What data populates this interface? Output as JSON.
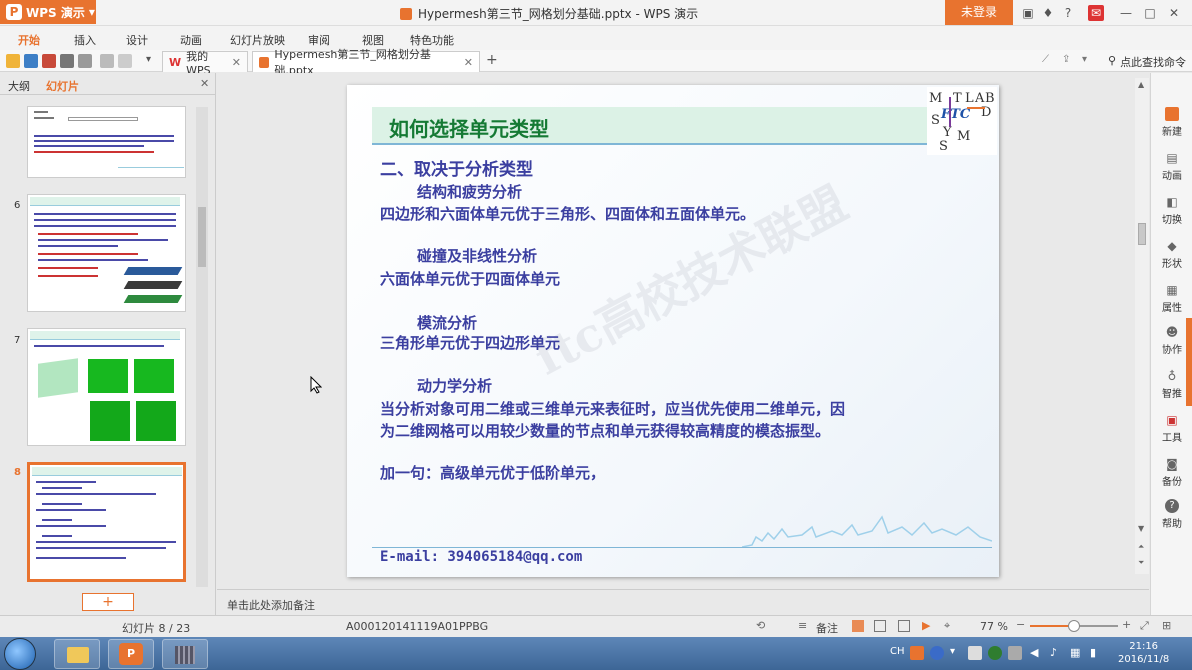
{
  "app": {
    "name": "WPS 演示",
    "doc_title": "Hypermesh第三节_网格划分基础.pptx - WPS 演示",
    "login_label": "未登录"
  },
  "menu": [
    "开始",
    "插入",
    "设计",
    "动画",
    "幻灯片放映",
    "审阅",
    "视图",
    "特色功能"
  ],
  "doc_tabs": [
    {
      "label": "我的WPS"
    },
    {
      "label": "Hypermesh第三节_网格划分基础.pptx"
    }
  ],
  "search_label": "点此查找命令",
  "panel": {
    "tab_outline": "大纲",
    "tab_slides": "幻灯片",
    "thumb_numbers": [
      "6",
      "7",
      "8"
    ]
  },
  "slide": {
    "title": "如何选择单元类型",
    "section": "二、取决于分析类型",
    "items": [
      {
        "heading": "结构和疲劳分析",
        "text": "四边形和六面体单元优于三角形、四面体和五面体单元。"
      },
      {
        "heading": "碰撞及非线性分析",
        "text": "六面体单元优于四面体单元"
      },
      {
        "heading": "模流分析",
        "text": "三角形单元优于四边形单元"
      },
      {
        "heading": "动力学分析",
        "text": "当分析对象可用二维或三维单元来表征时，应当优先使用二维单元，因",
        "text2": "为二维网格可以用较少数量的节点和单元获得较高精度的模态振型。"
      }
    ],
    "extra": "加一句：高级单元优于低阶单元，",
    "email": "E-mail: 394065184@qq.com",
    "watermark": "ftc高校技术联盟",
    "logo_letters": [
      "M",
      "T",
      "L",
      "A",
      "B",
      "FTC",
      "D",
      "S",
      "Y",
      "M",
      "S"
    ]
  },
  "right_sidebar": [
    "新建",
    "动画",
    "切换",
    "形状",
    "属性",
    "协作",
    "智推",
    "工具",
    "备份",
    "帮助"
  ],
  "notes_placeholder": "单击此处添加备注",
  "status": {
    "slide_counter": "幻灯片 8 / 23",
    "template_id": "A000120141119A01PPBG",
    "notes_label": "备注",
    "zoom": "77 %",
    "zoom_fraction": 0.5
  },
  "taskbar": {
    "time": "21:16",
    "date": "2016/11/8",
    "lang": "CH"
  },
  "colors": {
    "accent": "#e8732f",
    "slide_title": "#157a34",
    "slide_text": "#3b3fa0"
  }
}
